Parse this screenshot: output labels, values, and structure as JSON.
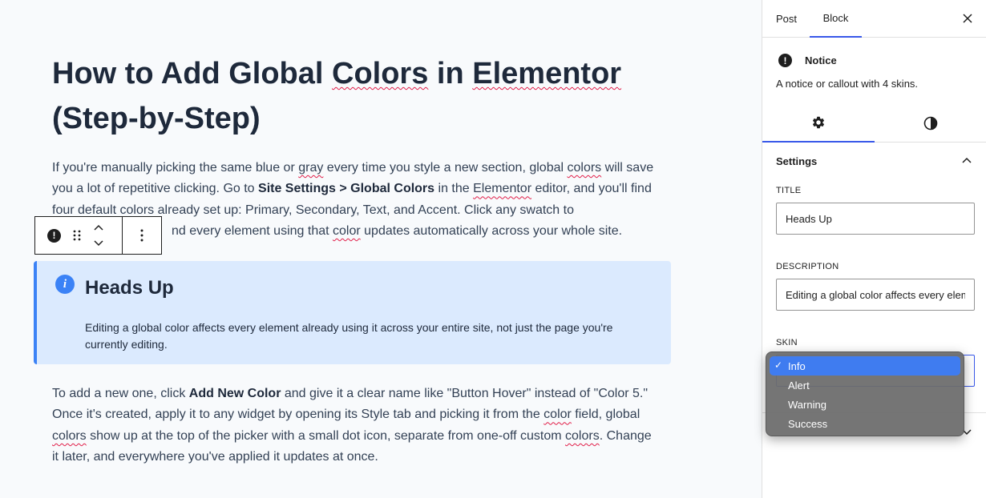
{
  "editor": {
    "title_parts": [
      "How to Add Global ",
      "Colors",
      " in ",
      "Elementor",
      " (Step-by-Step)"
    ],
    "para1": {
      "t1": "If you're manually picking the same blue or ",
      "t2": "gray",
      "t3": " every time you style a new section, global ",
      "t4": "colors",
      "t5": " will save you a lot of repetitive clicking. Go to ",
      "b1": "Site Settings > Global Colors",
      "t6": " in the ",
      "t7": "Elementor",
      "t8": " editor, and you'll find four default ",
      "t9": "colors",
      "t10": " already set up: Primary, Secondary, Text, and Accent. Click any swatch to",
      "t11": "nd every element using that ",
      "t12": "color",
      "t13": " updates automatically across your whole site."
    },
    "notice": {
      "title": "Heads Up",
      "description": "Editing a global color affects every element already using it across your entire site, not just the page you're currently editing."
    },
    "para2": {
      "t1": "To add a new one, click ",
      "b1": "Add New Color",
      "t2": " and give it a clear name like \"Button Hover\" instead of \"Color 5.\" Once it's created, apply it to any widget by opening its Style tab and picking it from the ",
      "t3": "color",
      "t4": " field, global ",
      "t5": "colors",
      "t6": " show up at the top of the picker with a small dot icon, separate from one-off custom ",
      "t7": "colors",
      "t8": ". Change it later, and everywhere you've applied it updates at once."
    }
  },
  "sidebar": {
    "tabs": [
      "Post",
      "Block"
    ],
    "block_card": {
      "title": "Notice",
      "description": "A notice or callout with 4 skins."
    },
    "panel_title": "Settings",
    "fields": {
      "title_label": "TITLE",
      "title_value": "Heads Up",
      "description_label": "DESCRIPTION",
      "description_value": "Editing a global color affects every element already using it across your entire site, not just the page you're currently editing.",
      "skin_label": "SKIN"
    },
    "skin_options": [
      "Info",
      "Alert",
      "Warning",
      "Success"
    ],
    "skin_selected": "Info",
    "check": "✓"
  },
  "colors": {
    "accent": "#3858e9",
    "notice_bg": "#dbeafe",
    "notice_border": "#3b82f6",
    "menu_selected": "#3f7cf0"
  }
}
